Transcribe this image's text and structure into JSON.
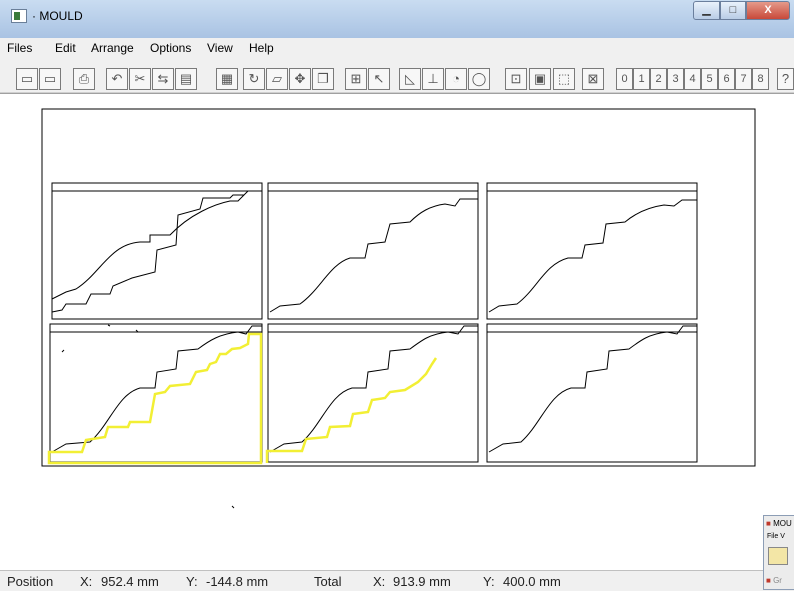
{
  "window": {
    "title": "· MOULD",
    "minimize_icon": "minimize-icon",
    "maximize_icon": "maximize-icon",
    "close_label": "X"
  },
  "menu": [
    "Files",
    "Edit",
    "Arrange",
    "Options",
    "View",
    "Help"
  ],
  "toolbar": {
    "icons": [
      "save-icon",
      "save-as-icon",
      "print-icon",
      "undo-icon",
      "cut-icon",
      "mirror-icon",
      "paste-icon",
      "grid-icon",
      "rotate-icon",
      "skew-icon",
      "move-icon",
      "copy-icon",
      "array-icon",
      "select-icon",
      "line-icon",
      "point-icon",
      "arc-icon",
      "ellipse-icon",
      "zoom-fit-icon",
      "zoom-window-icon",
      "zoom-page-icon",
      "zoom-select-icon"
    ],
    "numbers": [
      "0",
      "1",
      "2",
      "3",
      "4",
      "5",
      "6",
      "7",
      "8"
    ],
    "help_label": "?"
  },
  "status": {
    "position_label": "Position",
    "pos_x_label": "X:",
    "pos_x": "952.4 mm",
    "pos_y_label": "Y:",
    "pos_y": "-144.8 mm",
    "total_label": "Total",
    "total_x_label": "X:",
    "total_x": "913.9 mm",
    "total_y_label": "Y:",
    "total_y": "400.0 mm"
  },
  "mini_window": {
    "title": "MOU",
    "menu": "File V",
    "tab": "Gr"
  },
  "colors": {
    "selection": "#f2ef34",
    "outline": "#000000",
    "canvas": "#ffffff"
  }
}
